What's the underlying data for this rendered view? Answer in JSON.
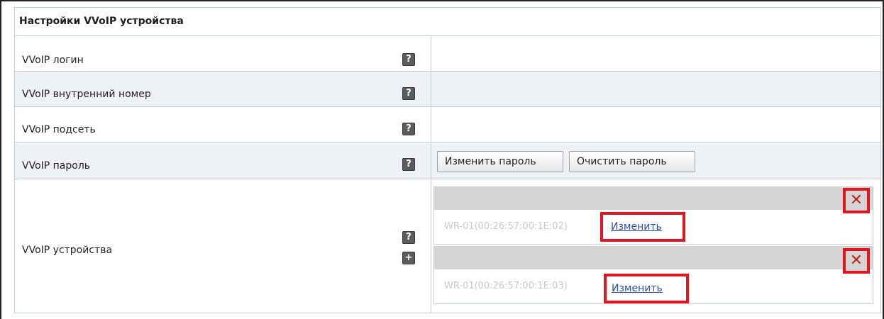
{
  "panel": {
    "title": "Настройки VVoIP устройства"
  },
  "rows": [
    {
      "label": "VVoIP логин"
    },
    {
      "label": "VVoIP внутренний номер"
    },
    {
      "label": "VVoIP подсеть"
    },
    {
      "label": "VVoIP пароль"
    },
    {
      "label": "VVoIP устройства"
    }
  ],
  "help_symbol": "?",
  "add_symbol": "+",
  "password": {
    "change_label": "Изменить пароль",
    "clear_label": "Очистить пароль"
  },
  "devices": [
    {
      "name": "WR-01(00:26:57:00:1E:02)",
      "change_label": "Изменить",
      "delete_symbol": "✕"
    },
    {
      "name": "WR-01(00:26:57:00:1E:03)",
      "change_label": "Изменить",
      "delete_symbol": "✕"
    }
  ],
  "colors": {
    "highlight": "#e0151f",
    "link": "#2a4fb5",
    "alt_row": "#eef1f5"
  }
}
